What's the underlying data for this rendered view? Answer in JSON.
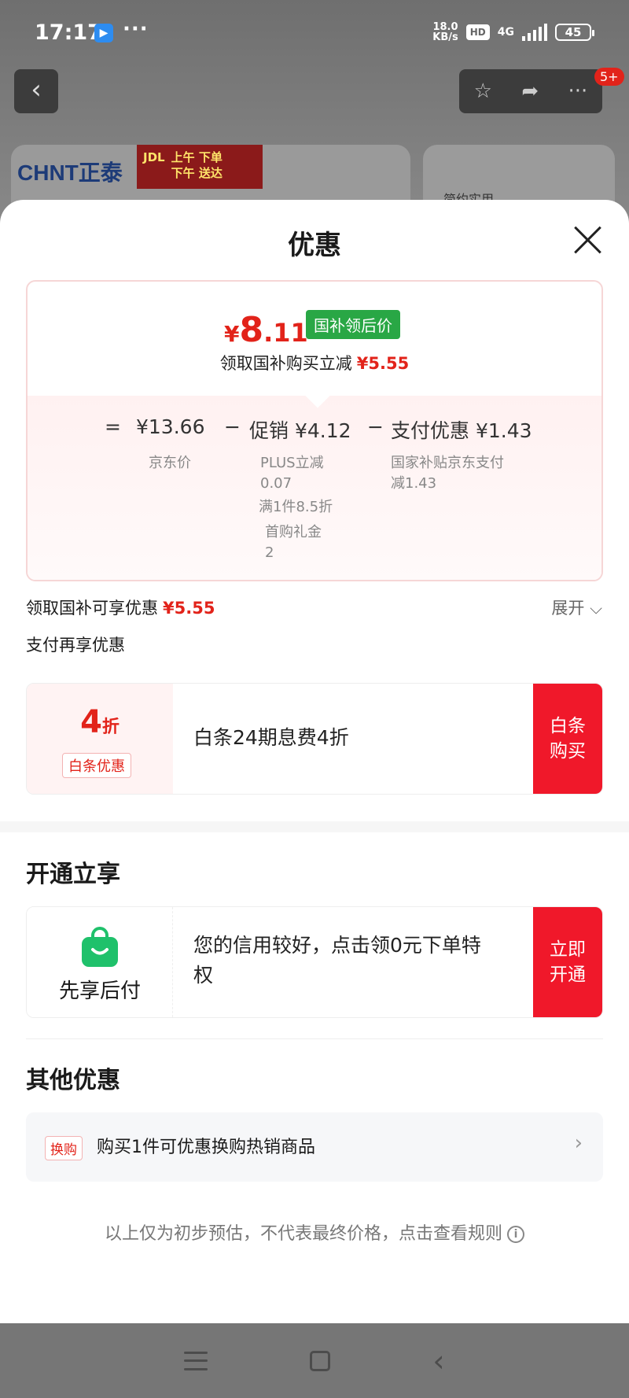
{
  "status_bar": {
    "time": "17:17",
    "dots": "···",
    "net_speed": "18.0",
    "net_unit": "KB/s",
    "hd": "HD",
    "signal": "4G",
    "battery": "45"
  },
  "background": {
    "back_icon": "‹",
    "badge": "5+",
    "brand": "CHNT正泰",
    "jd_logo": "JDL",
    "jd_line1": "上午 下单",
    "jd_line2": "下午 送达",
    "banner_right_text": "简约实用"
  },
  "sheet": {
    "title": "优惠",
    "final_price_yen": "¥",
    "final_price_int": "8",
    "final_price_dec": ".11",
    "gb_tag": "国补领后价",
    "claim_text": "领取国补购买立减",
    "claim_amount": "¥5.55",
    "calc": {
      "eq": "=",
      "jd_price": "¥13.66",
      "minus1": "−",
      "promo": "促销 ¥4.12",
      "minus2": "−",
      "pay": "支付优惠 ¥1.43",
      "jd_price_label": "京东价",
      "promo_detail_1": "PLUS立减",
      "promo_detail_1b": "0.07",
      "promo_detail_2": "满1件8.5折",
      "promo_detail_3": "首购礼金",
      "promo_detail_3b": "2",
      "pay_detail_1": "国家补贴京东支付",
      "pay_detail_1b": "减1.43"
    },
    "claim_total_label": "领取国补可享优惠",
    "claim_total_amount": "¥5.55",
    "expand_label": "展开 ⌵",
    "pay_more_label": "支付再享优惠",
    "baitiao": {
      "discount_num": "4",
      "discount_unit": "折",
      "tag": "白条优惠",
      "text": "白条24期息费4折",
      "action_line1": "白条",
      "action_line2": "购买"
    },
    "open_section_title": "开通立享",
    "credit": {
      "label": "先享后付",
      "text_line1": "您的信用较好，点击领0元下单特",
      "text_line2": "权",
      "action_line1": "立即",
      "action_line2": "开通"
    },
    "other_section_title": "其他优惠",
    "other": {
      "tag": "换购",
      "text": "购买1件可优惠换购热销商品",
      "chevron": "›"
    },
    "footnote": "以上仅为初步预估，不代表最终价格，点击查看规则",
    "info_icon": "i"
  },
  "icons": {
    "close": "close-icon",
    "star": "star-icon",
    "share": "share-icon",
    "more": "more-icon",
    "bag": "shopping-bag-icon"
  },
  "colors": {
    "accent_red": "#e2231a",
    "action_red": "#f0182a",
    "gb_green": "#29a745",
    "bag_green": "#1fc16b"
  }
}
